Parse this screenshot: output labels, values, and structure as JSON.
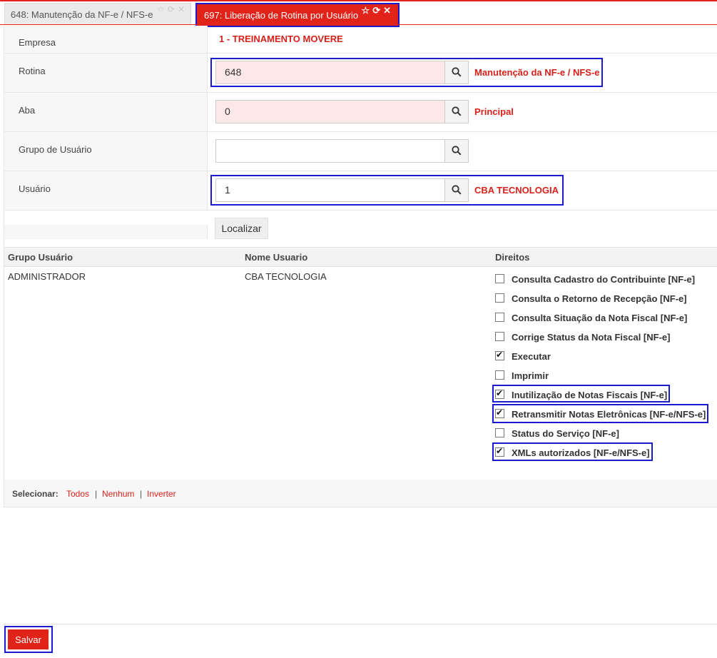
{
  "tabs": [
    {
      "label": "648: Manutenção da NF-e / NFS-e"
    },
    {
      "label": "697: Liberação de Rotina por Usuário"
    }
  ],
  "form": {
    "empresa": {
      "label": "Empresa",
      "value": "1 - TREINAMENTO MOVERE"
    },
    "rotina": {
      "label": "Rotina",
      "value": "648",
      "desc": "Manutenção da NF-e / NFS-e"
    },
    "aba": {
      "label": "Aba",
      "value": "0",
      "desc": "Principal"
    },
    "grupo": {
      "label": "Grupo de Usuário",
      "value": ""
    },
    "usuario": {
      "label": "Usuário",
      "value": "1",
      "desc": "CBA TECNOLOGIA"
    },
    "localizar_label": "Localizar"
  },
  "table": {
    "headers": [
      "Grupo Usuário",
      "Nome Usuario",
      "Direitos"
    ],
    "row": {
      "grupo": "ADMINISTRADOR",
      "nome": "CBA TECNOLOGIA"
    },
    "rights": [
      {
        "label": "Consulta Cadastro do Contribuinte [NF-e]",
        "checked": false
      },
      {
        "label": "Consulta o Retorno de Recepção [NF-e]",
        "checked": false
      },
      {
        "label": "Consulta Situação da Nota Fiscal [NF-e]",
        "checked": false
      },
      {
        "label": "Corrige Status da Nota Fiscal [NF-e]",
        "checked": false
      },
      {
        "label": "Executar",
        "checked": true
      },
      {
        "label": "Imprimir",
        "checked": false
      },
      {
        "label": "Inutilização de Notas Fiscais [NF-e]",
        "checked": true
      },
      {
        "label": "Retransmitir Notas Eletrônicas [NF-e/NFS-e]",
        "checked": true
      },
      {
        "label": "Status do Serviço [NF-e]",
        "checked": false
      },
      {
        "label": "XMLs autorizados [NF-e/NFS-e]",
        "checked": true
      }
    ]
  },
  "selecionar": {
    "label": "Selecionar:",
    "todos": "Todos",
    "nenhum": "Nenhum",
    "inverter": "Inverter",
    "separator": "|"
  },
  "salvar_label": "Salvar",
  "colors": {
    "accent": "#e2231a",
    "highlight": "#1a1ad0",
    "input_pink": "#fde8e8"
  }
}
